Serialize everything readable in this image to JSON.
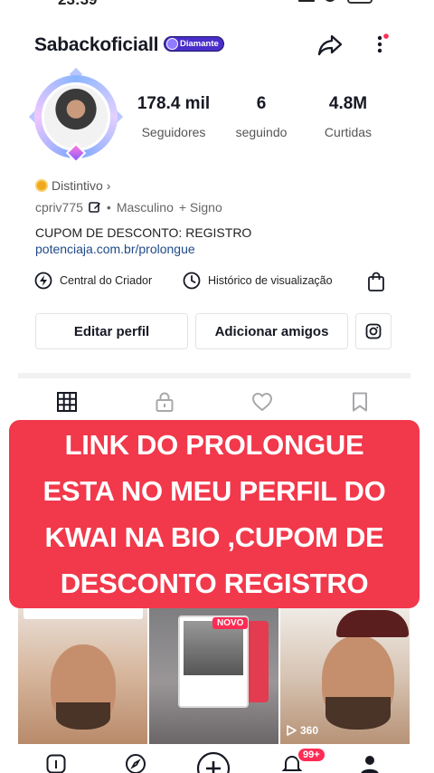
{
  "status_bar": {
    "time": "23:39"
  },
  "header": {
    "username": "Sabackoficiall",
    "badge_label": "Diamante",
    "share_icon": "share-arrow-icon",
    "more_icon": "more-dots-icon",
    "notification_dot_color": "#fe2c55"
  },
  "stats": [
    {
      "value": "178.4 mil",
      "label": "Seguidores"
    },
    {
      "value": "6",
      "label": "seguindo"
    },
    {
      "value": "4.8M",
      "label": "Curtidas"
    }
  ],
  "profile": {
    "distintivo_label": "Distintivo",
    "distintivo_chevron": "›",
    "handle": "cpriv775",
    "separator": "•",
    "gender": "Masculino",
    "sign_label": "+ Signo",
    "bio": "CUPOM DE DESCONTO: REGISTRO",
    "link": "potenciaja.com.br/prolongue"
  },
  "tools": {
    "creator_center": "Central do Criador",
    "watch_history": "Histórico de visualização"
  },
  "buttons": {
    "edit_profile": "Editar perfil",
    "add_friends": "Adicionar amigos"
  },
  "banner": {
    "text": "LINK DO PROLONGUE\nESTA NO MEU PERFIL DO\nKWAI NA BIO ,CUPOM DE\nDESCONTO REGISTRO",
    "background": "#f2384b"
  },
  "videos": [
    {
      "caption": "",
      "views": ""
    },
    {
      "label": "NOVO",
      "views": ""
    },
    {
      "views": "360"
    }
  ],
  "bottom_nav": {
    "notification_count": "99+"
  },
  "colors": {
    "accent": "#fe2c55",
    "badge": "#4a2ec9",
    "link": "#1f4a8a"
  }
}
